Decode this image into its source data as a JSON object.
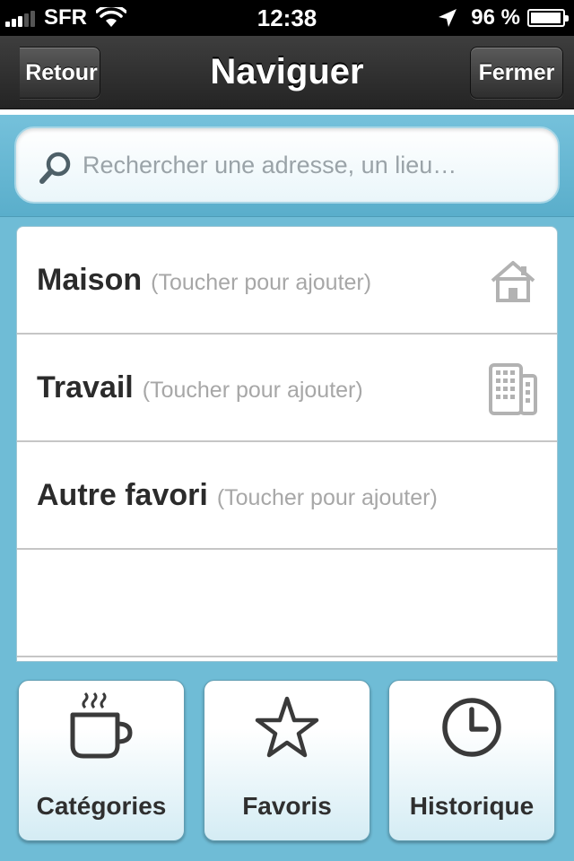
{
  "status_bar": {
    "carrier": "SFR",
    "time": "12:38",
    "battery": "96 %",
    "battery_level": 0.96
  },
  "nav": {
    "title": "Naviguer",
    "back_label": "Retour",
    "close_label": "Fermer"
  },
  "search": {
    "placeholder": "Rechercher une adresse, un lieu…"
  },
  "favorites": [
    {
      "label": "Maison",
      "hint": "(Toucher pour ajouter)",
      "icon": "house-icon"
    },
    {
      "label": "Travail",
      "hint": "(Toucher pour ajouter)",
      "icon": "office-building-icon"
    },
    {
      "label": "Autre favori",
      "hint": "(Toucher pour ajouter)",
      "icon": ""
    }
  ],
  "bottom_tabs": [
    {
      "label": "Catégories",
      "icon": "coffee-cup-icon"
    },
    {
      "label": "Favoris",
      "icon": "star-icon"
    },
    {
      "label": "Historique",
      "icon": "clock-icon"
    }
  ],
  "colors": {
    "background": "#6fbcd6",
    "nav_bar": "#2e2e2e",
    "text_dark": "#2b2b2b",
    "hint_gray": "#a7a7a7"
  }
}
